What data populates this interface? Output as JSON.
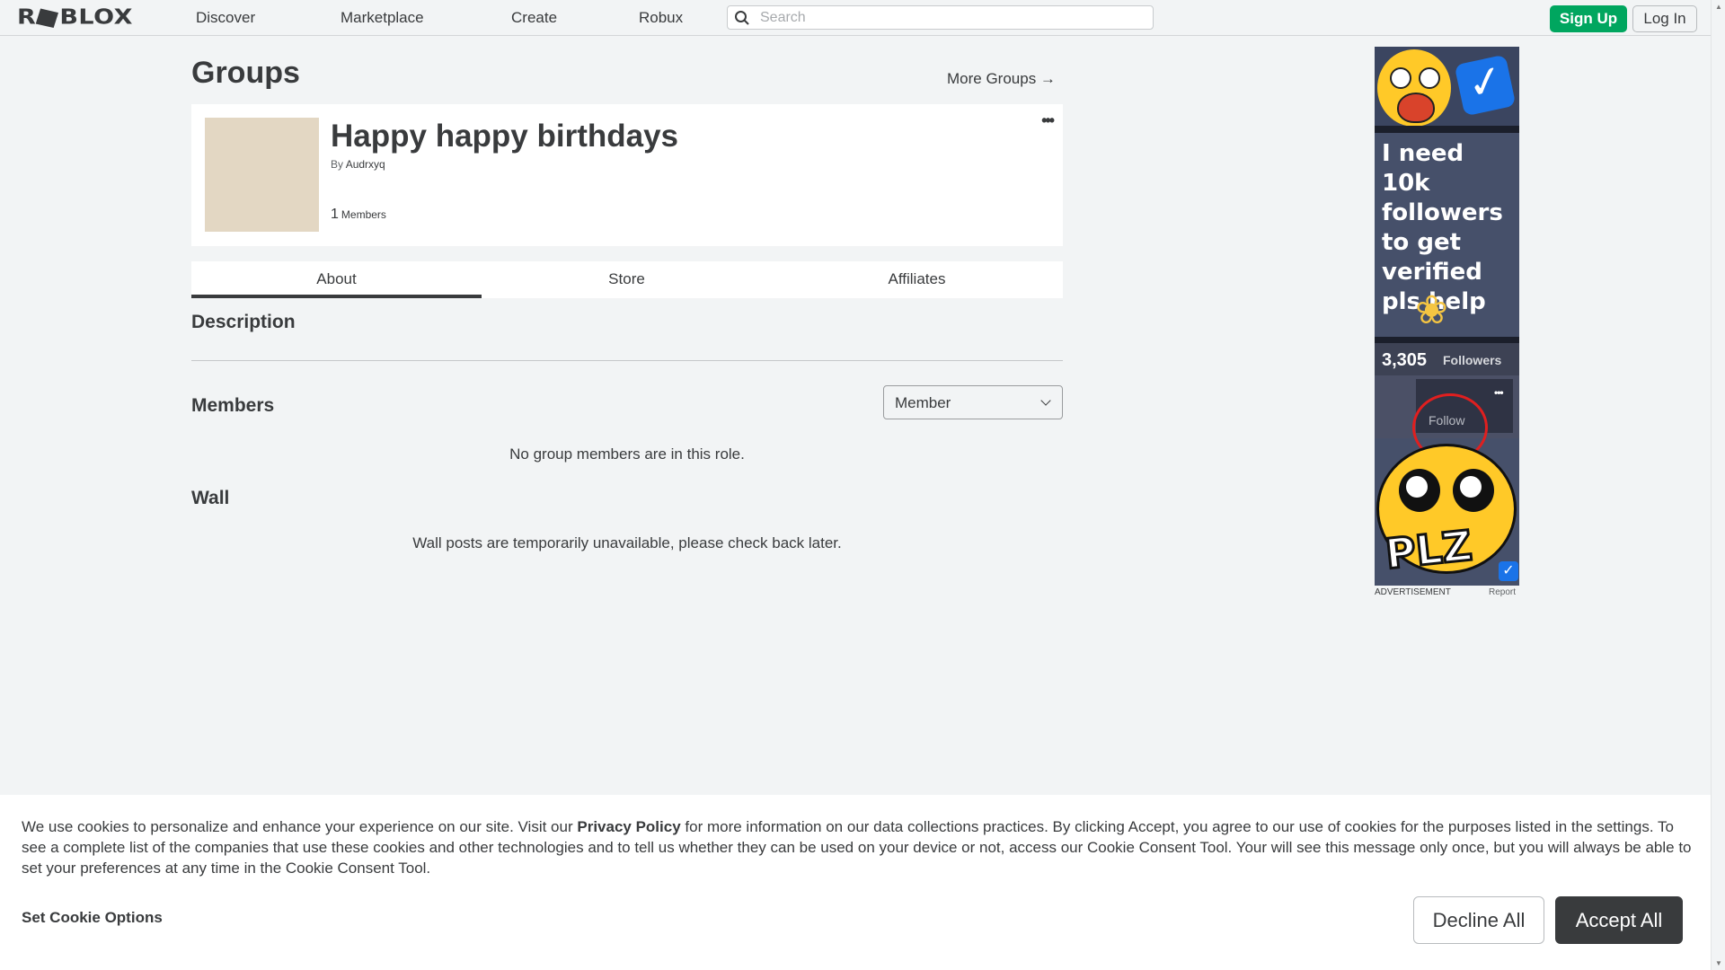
{
  "nav": {
    "logo": "ROBLOX",
    "links": [
      "Discover",
      "Marketplace",
      "Create",
      "Robux"
    ],
    "search_placeholder": "Search",
    "signup": "Sign Up",
    "login": "Log In"
  },
  "page": {
    "title": "Groups",
    "more_groups": "More Groups →"
  },
  "group": {
    "name": "Happy happy birthdays",
    "by_label": "By",
    "owner": "Audrxyq",
    "member_count": "1",
    "members_label": "Members",
    "menu_icon": "ellipsis-icon"
  },
  "tabs": [
    "About",
    "Store",
    "Affiliates"
  ],
  "active_tab": "About",
  "sections": {
    "description": "Description",
    "members": "Members",
    "role_selected": "Member",
    "members_empty": "No group members are in this role.",
    "wall": "Wall",
    "wall_msg": "Wall posts are temporarily unavailable, please check back later."
  },
  "ad": {
    "headline": "I need 10k followers to get verified pls help",
    "followers_count": "3,305",
    "followers_label": "Followers",
    "follow_label": "Follow",
    "plz": "PLZ",
    "label": "ADVERTISEMENT",
    "report": "Report"
  },
  "cookie": {
    "text_before": "We use cookies to personalize and enhance your experience on our site. Visit our ",
    "privacy_link": "Privacy Policy",
    "text_after": " for more information on our data collections practices. By clicking Accept, you agree to our use of cookies for the purposes listed in the settings. To see a complete list of the companies that use these cookies and other technologies and to tell us whether they can be used on your device or not, access our Cookie Consent Tool. Your will see this message only once, but you will always be able to set your preferences at any time in the Cookie Consent Tool.",
    "set_options": "Set Cookie Options",
    "decline": "Decline All",
    "accept": "Accept All"
  },
  "colors": {
    "background": "#f2f4f5",
    "signup_green": "#00a65f",
    "accept_dark": "#393b3d",
    "text": "#393b3d"
  }
}
